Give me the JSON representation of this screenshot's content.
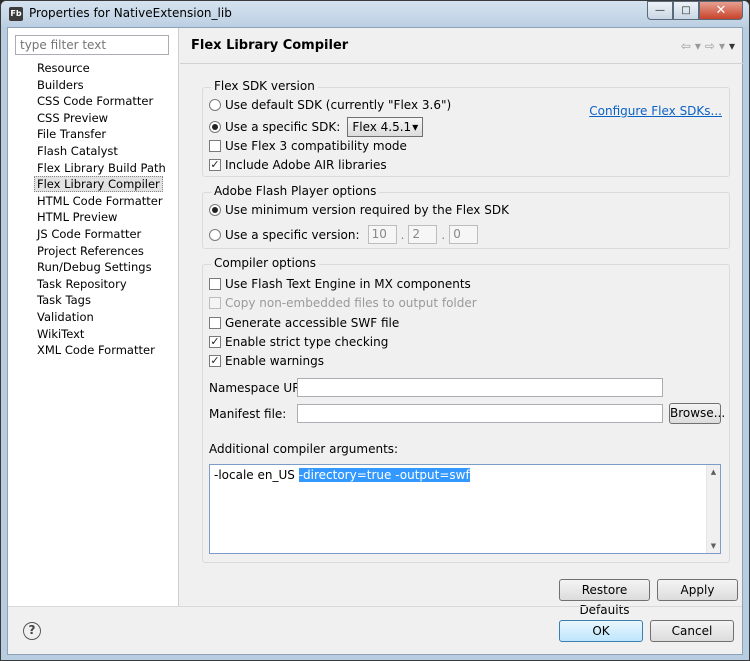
{
  "window": {
    "title": "Properties for NativeExtension_lib",
    "app_icon": "Fb",
    "min_glyph": "—",
    "max_glyph": "□",
    "close_glyph": "✕"
  },
  "filter": {
    "placeholder": "type filter text"
  },
  "nav": {
    "items": [
      "Resource",
      "Builders",
      "CSS Code Formatter",
      "CSS Preview",
      "File Transfer",
      "Flash Catalyst",
      "Flex Library Build Path",
      "Flex Library Compiler",
      "HTML Code Formatter",
      "HTML Preview",
      "JS Code Formatter",
      "Project References",
      "Run/Debug Settings",
      "Task Repository",
      "Task Tags",
      "Validation",
      "WikiText",
      "XML Code Formatter"
    ],
    "selected": "Flex Library Compiler"
  },
  "page": {
    "title": "Flex Library Compiler",
    "back_glyph": "⇦",
    "forward_glyph": "⇨",
    "dropdown_glyph": "▾",
    "menu_glyph": "▾"
  },
  "sdk": {
    "group_label": "Flex SDK version",
    "default_label": "Use default SDK (currently \"Flex 3.6\")",
    "specific_label": "Use a specific SDK:",
    "specific_value": "Flex 4.5.1",
    "combo_arrow": "▾",
    "configure_link": "Configure Flex SDKs...",
    "flex3_label": "Use Flex 3 compatibility mode",
    "air_label": "Include Adobe AIR libraries",
    "check_glyph": "✓"
  },
  "player": {
    "group_label": "Adobe Flash Player options",
    "minimum_label": "Use minimum version required by the Flex SDK",
    "specific_label": "Use a specific version:",
    "major": "10",
    "minor": "2",
    "revision": "0",
    "dot": "."
  },
  "compiler": {
    "group_label": "Compiler options",
    "text_engine_label": "Use Flash Text Engine in MX components",
    "copy_files_label": "Copy non-embedded files to output folder",
    "accessible_label": "Generate accessible SWF file",
    "strict_label": "Enable strict type checking",
    "warnings_label": "Enable warnings",
    "namespace_label": "Namespace URL:",
    "manifest_label": "Manifest file:",
    "browse_label": "Browse...",
    "args_label": "Additional compiler arguments:",
    "args_plain": "-locale en_US ",
    "args_selected": "-directory=true -output=swf",
    "scroll_up": "▲",
    "scroll_down": "▼"
  },
  "buttons": {
    "restore": "Restore Defaults",
    "apply": "Apply",
    "ok": "OK",
    "cancel": "Cancel",
    "help": "?"
  }
}
